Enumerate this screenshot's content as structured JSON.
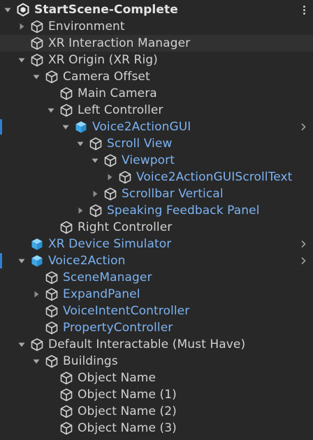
{
  "hierarchy": {
    "scene_title": "StartScene-Complete",
    "items": [
      {
        "label": "Environment"
      },
      {
        "label": "XR Interaction Manager"
      },
      {
        "label": "XR Origin (XR Rig)"
      },
      {
        "label": "Camera Offset"
      },
      {
        "label": "Main Camera"
      },
      {
        "label": "Left Controller"
      },
      {
        "label": "Voice2ActionGUI"
      },
      {
        "label": "Scroll View"
      },
      {
        "label": "Viewport"
      },
      {
        "label": "Voice2ActionGUIScrollText"
      },
      {
        "label": "Scrollbar Vertical"
      },
      {
        "label": "Speaking Feedback Panel"
      },
      {
        "label": "Right Controller"
      },
      {
        "label": "XR Device Simulator"
      },
      {
        "label": "Voice2Action"
      },
      {
        "label": "SceneManager"
      },
      {
        "label": "ExpandPanel"
      },
      {
        "label": "VoiceIntentController"
      },
      {
        "label": "PropertyController"
      },
      {
        "label": "Default Interactable (Must Have)"
      },
      {
        "label": "Buildings"
      },
      {
        "label": "Object Name"
      },
      {
        "label": "Object Name (1)"
      },
      {
        "label": "Object Name (2)"
      },
      {
        "label": "Object Name (3)"
      }
    ]
  },
  "colors": {
    "background": "#282828",
    "text": "#d2d2d2",
    "prefab_text": "#7cb3f2",
    "prefab_icon": "#5fbff5",
    "selection_marker": "#2f80d4"
  }
}
